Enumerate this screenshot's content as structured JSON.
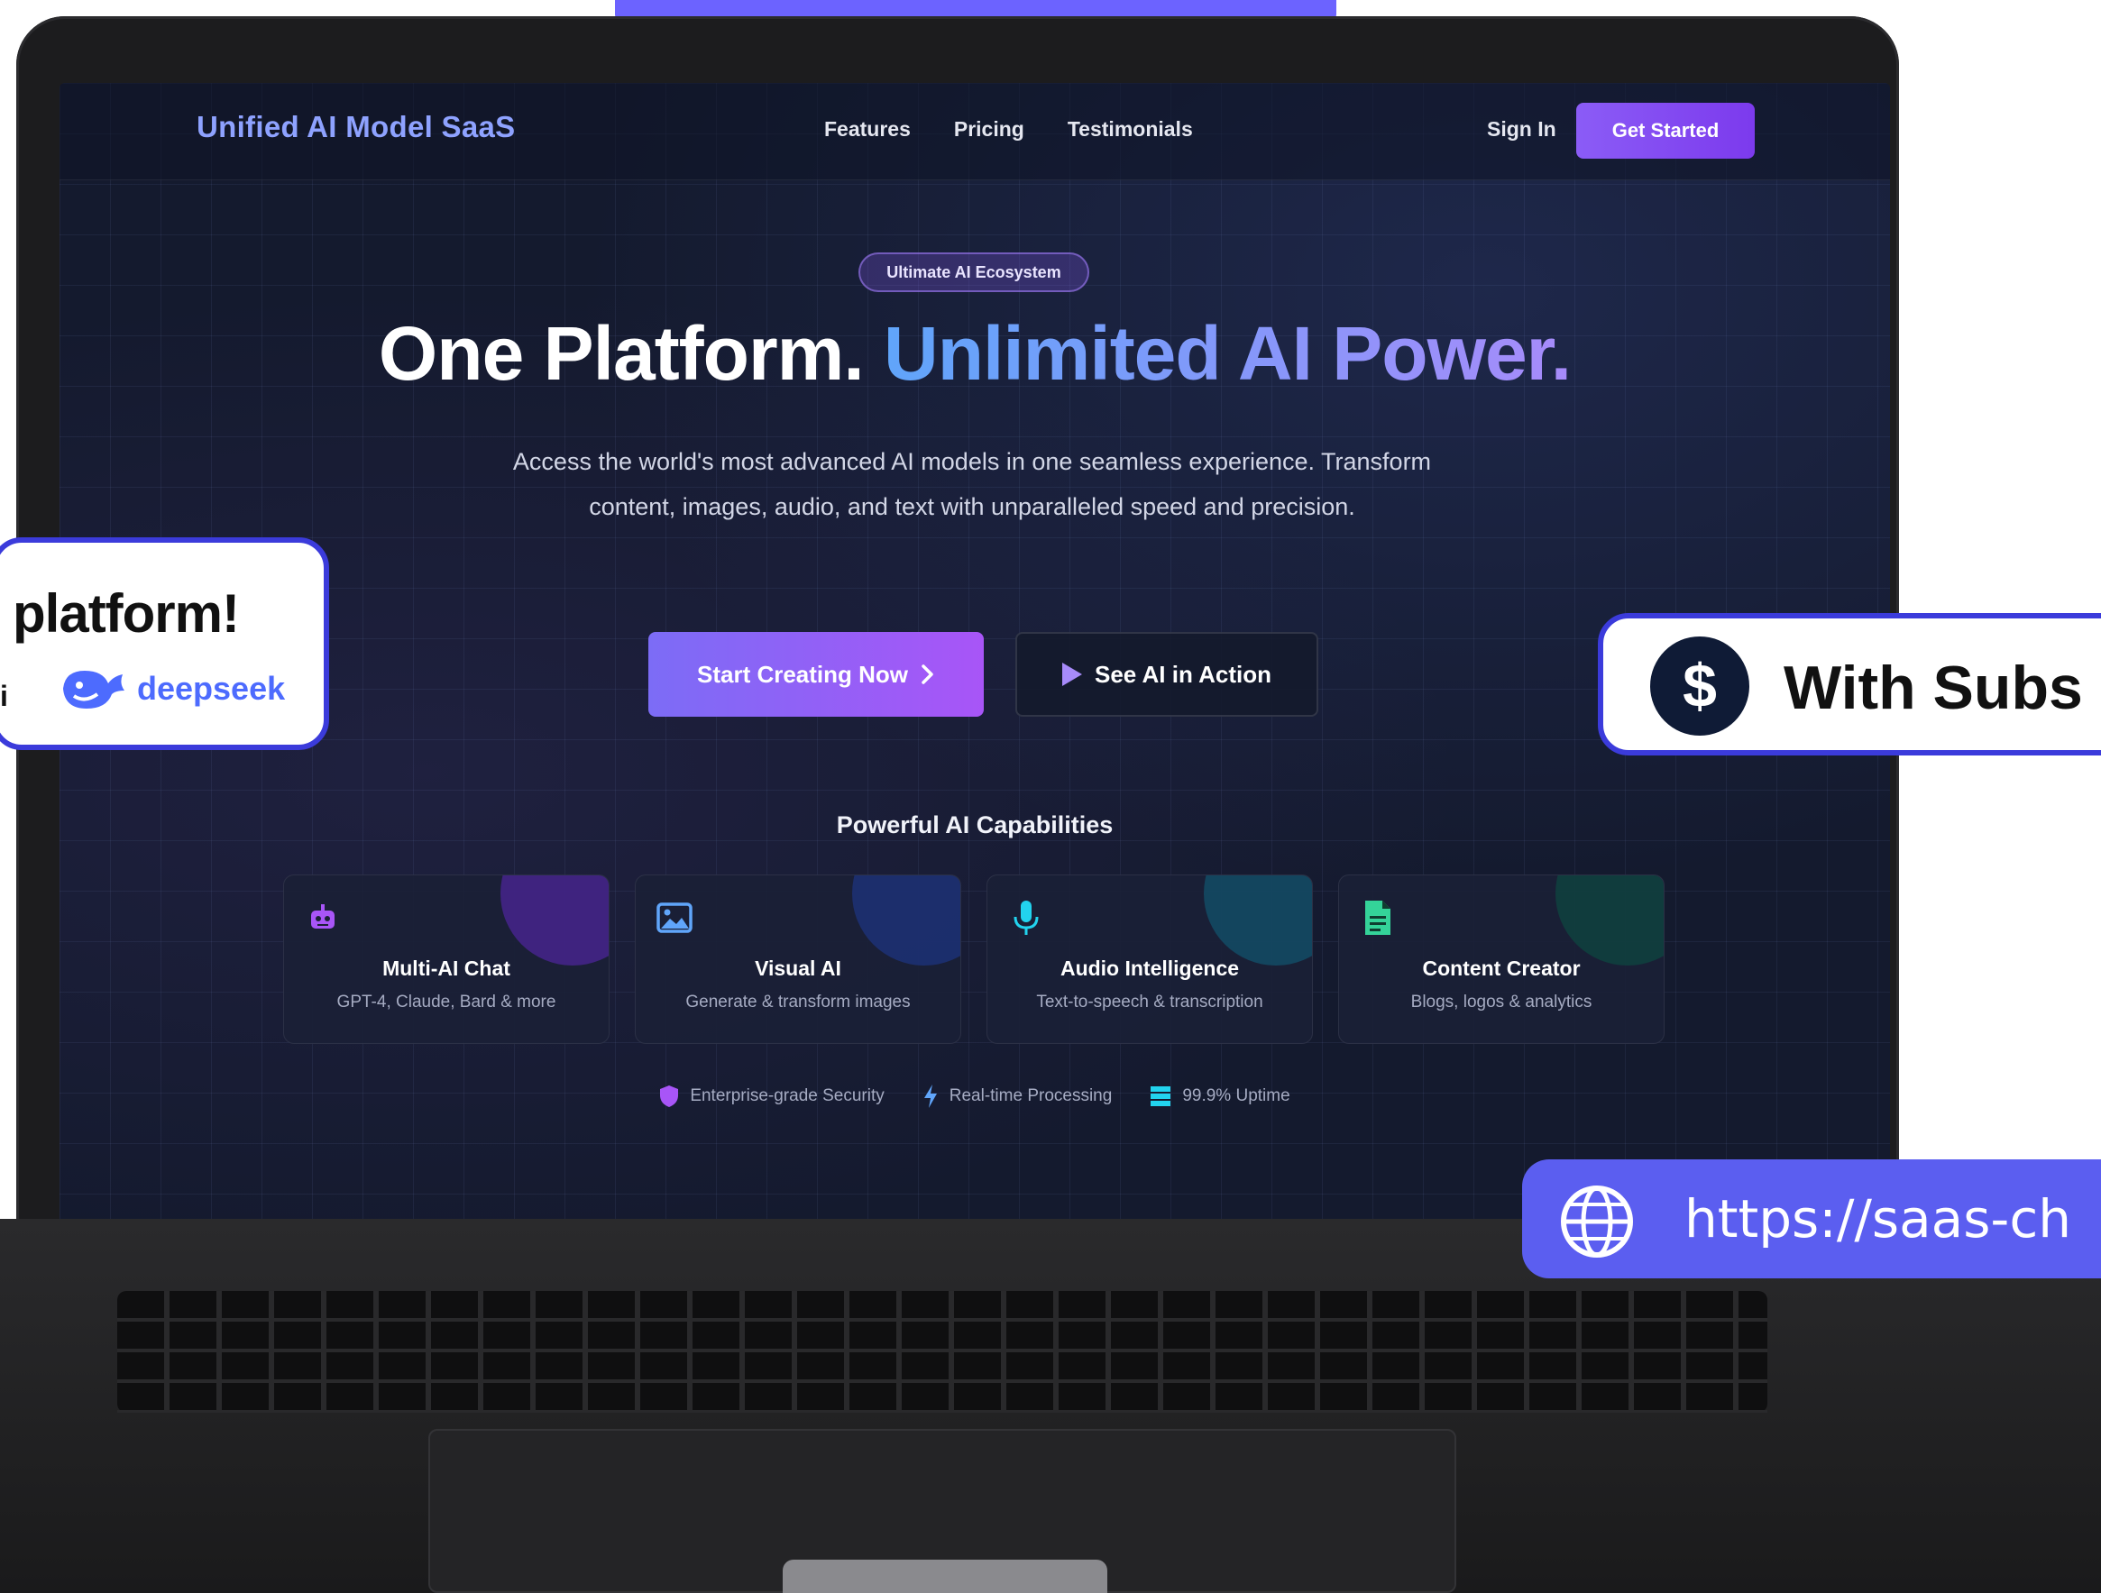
{
  "nav": {
    "brand": "Unified AI Model SaaS",
    "links": [
      "Features",
      "Pricing",
      "Testimonials"
    ],
    "sign_in": "Sign In",
    "get_started": "Get Started"
  },
  "hero": {
    "badge": "Ultimate AI Ecosystem",
    "title_white": "One Platform.",
    "title_accent": "Unlimited AI Power.",
    "subtitle": "Access the world's most advanced AI models in one seamless experience. Transform content, images, audio, and text with unparalleled speed and precision.",
    "primary_cta": "Start Creating Now",
    "secondary_cta": "See AI in Action"
  },
  "capabilities": {
    "title": "Powerful AI Capabilities",
    "cards": [
      {
        "title": "Multi-AI Chat",
        "desc": "GPT-4, Claude, Bard & more",
        "icon": "robot-icon",
        "color": "#a855f7"
      },
      {
        "title": "Visual AI",
        "desc": "Generate & transform images",
        "icon": "image-icon",
        "color": "#60a5fa"
      },
      {
        "title": "Audio Intelligence",
        "desc": "Text-to-speech & transcription",
        "icon": "microphone-icon",
        "color": "#22d3ee"
      },
      {
        "title": "Content Creator",
        "desc": "Blogs, logos & analytics",
        "icon": "document-icon",
        "color": "#34d399"
      }
    ]
  },
  "features": [
    {
      "label": "Enterprise-grade Security",
      "icon": "shield-icon"
    },
    {
      "label": "Real-time Processing",
      "icon": "lightning-icon"
    },
    {
      "label": "99.9% Uptime",
      "icon": "server-icon"
    }
  ],
  "overlays": {
    "left_title": "platform!",
    "left_fragment": "i",
    "left_logo": "deepseek",
    "right_text": "With Subs",
    "url_text": "https://saas-ch"
  },
  "colors": {
    "accent": "#8b5cf6",
    "brand": "#8ea2ff",
    "overlay_border": "#3b3bdb",
    "url_bg": "#5b5ef0"
  }
}
